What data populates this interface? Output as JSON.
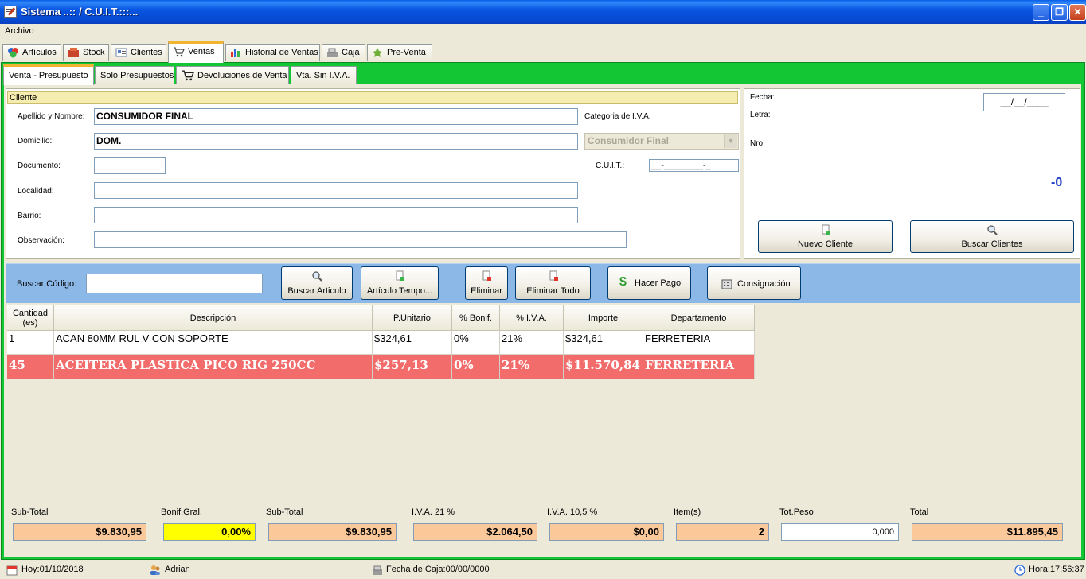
{
  "window": {
    "title": "Sistema ..:: / C.U.I.T.:::..."
  },
  "menu": {
    "archivo": "Archivo"
  },
  "tabs": [
    {
      "label": "Artículos",
      "icon": "articulos-icon"
    },
    {
      "label": "Stock",
      "icon": "stock-icon"
    },
    {
      "label": "Clientes",
      "icon": "clientes-icon"
    },
    {
      "label": "Ventas",
      "icon": "cart-icon"
    },
    {
      "label": "Historial de Ventas",
      "icon": "chart-icon"
    },
    {
      "label": "Caja",
      "icon": "register-icon"
    },
    {
      "label": "Pre-Venta",
      "icon": "preventa-icon"
    }
  ],
  "tabs_text": {
    "t0": "Artículos",
    "t1": "Stock",
    "t2": "Clientes",
    "t3": "Ventas",
    "t4": "Historial de Ventas",
    "t5": "Caja",
    "t6": "Pre-Venta"
  },
  "subtabs": {
    "s0": "Venta - Presupuesto",
    "s1": "Solo Presupuestos",
    "s2": "Devoluciones de Venta",
    "s3": "Vta. Sin I.V.A."
  },
  "cliente": {
    "header": "Cliente",
    "apellido_label": "Apellido y Nombre:",
    "apellido_value": "CONSUMIDOR FINAL",
    "domicilio_label": "Domicilio:",
    "domicilio_value": "DOM.",
    "documento_label": "Documento:",
    "documento_value": "",
    "localidad_label": "Localidad:",
    "localidad_value": "",
    "barrio_label": "Barrio:",
    "barrio_value": "",
    "observacion_label": "Observación:",
    "observacion_value": "",
    "categoria_label": "Categoria de I.V.A.",
    "categoria_value": "Consumidor Final",
    "cuit_label": "C.U.I.T.:",
    "cuit_value": "__-________-_"
  },
  "comprobante": {
    "fecha_label": "Fecha:",
    "fecha_value": "__/__/____",
    "letra_label": "Letra:",
    "nro_label": "Nro:",
    "nro_value": "-0",
    "nuevo_cliente": "Nuevo Cliente",
    "buscar_clientes": "Buscar Clientes"
  },
  "search": {
    "label": "Buscar Código:",
    "value": "",
    "buscar_articulo": "Buscar Articulo",
    "articulo_temporal": "Artículo Tempo...",
    "eliminar": "Eliminar",
    "eliminar_todo": "Eliminar Todo",
    "hacer_pago": "Hacer Pago",
    "consignacion": "Consignación"
  },
  "grid": {
    "headers": {
      "cantidad": "Cantidad (es)",
      "descripcion": "Descripción",
      "unitario": "P.Unitario",
      "bonif": "% Bonif.",
      "iva": "% I.V.A.",
      "importe": "Importe",
      "departamento": "Departamento"
    },
    "rows": [
      {
        "cantidad": "1",
        "descripcion": "ACAN 80MM RUL V CON SOPORTE",
        "unitario": "$324,61",
        "bonif": "0%",
        "iva": "21%",
        "importe": "$324,61",
        "departamento": "FERRETERIA"
      },
      {
        "cantidad": "45",
        "descripcion": "ACEITERA PLASTICA PICO RIG 250CC",
        "unitario": "$257,13",
        "bonif": "0%",
        "iva": "21%",
        "importe": "$11.570,84",
        "departamento": "FERRETERIA"
      }
    ]
  },
  "totals": {
    "subtotal1_label": "Sub-Total",
    "subtotal1_value": "$9.830,95",
    "bonif_label": "Bonif.Gral.",
    "bonif_value": "0,00%",
    "subtotal2_label": "Sub-Total",
    "subtotal2_value": "$9.830,95",
    "iva21_label": "I.V.A. 21 %",
    "iva21_value": "$2.064,50",
    "iva105_label": "I.V.A. 10,5 %",
    "iva105_value": "$0,00",
    "items_label": "Item(s)",
    "items_value": "2",
    "peso_label": "Tot.Peso",
    "peso_value": "0,000",
    "total_label": "Total",
    "total_value": "$11.895,45"
  },
  "status": {
    "hoy": "Hoy:01/10/2018",
    "user": "Adrian",
    "fecha_caja": "Fecha de Caja:00/00/0000",
    "hora": "Hora:17:56:37"
  },
  "colors": {
    "accent": "#13C734",
    "highlight_row": "#F26C6C",
    "search_bar": "#8CB8E8",
    "total_fields": "#FBC89A",
    "bonif_field": "#FFFF00"
  }
}
